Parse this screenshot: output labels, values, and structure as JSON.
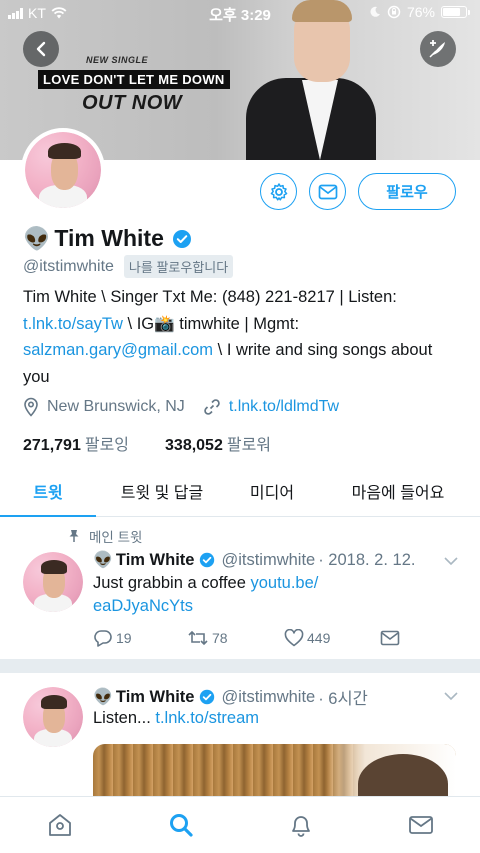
{
  "status_bar": {
    "carrier": "KT",
    "time": "오후 3:29",
    "battery": "76%"
  },
  "header": {
    "promo_small": "NEW SINGLE",
    "promo_title": "LOVE DON'T LET ME DOWN",
    "promo_out": "OUT NOW"
  },
  "profile": {
    "emoji": "👽",
    "name": "Tim White",
    "handle": "@itstimwhite",
    "follows_you": "나를 팔로우합니다",
    "follow_label": "팔로우",
    "bio": {
      "line1": "Tim White \\ Singer Txt Me: (848) 221-8217 | Listen:",
      "link1": "t.lnk.to/sayTw",
      "mid": " \\ IG📸 timwhite | Mgmt:",
      "email": "salzman.gary@gmail.com",
      "tail": " \\ I write and sing songs about you"
    },
    "location": "New Brunswick, NJ",
    "website": "t.lnk.to/ldlmdTw",
    "following_count": "271,791",
    "following_label": "팔로잉",
    "followers_count": "338,052",
    "followers_label": "팔로워"
  },
  "tabs": [
    {
      "label": "트윗"
    },
    {
      "label": "트윗 및 답글"
    },
    {
      "label": "미디어"
    },
    {
      "label": "마음에 들어요"
    }
  ],
  "pinned_label": "메인 트윗",
  "tweets": [
    {
      "name": "Tim White",
      "handle": "@itstimwhite",
      "time": "· 2018. 2. 12.",
      "text": "Just grabbin a coffee ",
      "link": "youtu.be/",
      "link2": "eaDJyaNcYts",
      "replies": "19",
      "retweets": "78",
      "likes": "449"
    },
    {
      "name": "Tim White",
      "handle": "@itstimwhite",
      "time": "· 6시간",
      "text": "Listen... ",
      "link": "t.lnk.to/stream"
    }
  ],
  "colors": {
    "accent": "#1da1f2",
    "link": "#1b95e0",
    "muted": "#657786"
  }
}
